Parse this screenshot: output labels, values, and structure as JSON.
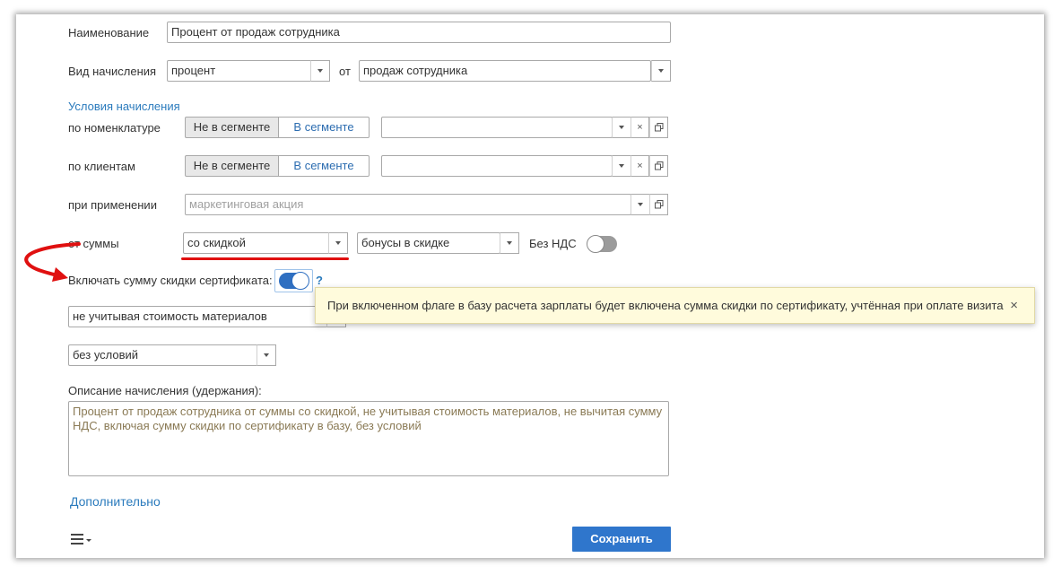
{
  "form": {
    "name_label": "Наименование",
    "name_value": "Процент от  продаж сотрудника",
    "accrual_type_label": "Вид начисления",
    "accrual_type_value": "процент",
    "from_label": "от",
    "from_value": "продаж сотрудника",
    "conditions_header": "Условия начисления",
    "nomenclature": {
      "label": "по номенклатуре",
      "not_in_segment": "Не в сегменте",
      "in_segment": "В сегменте",
      "value": "",
      "clear_symbol": "×"
    },
    "clients": {
      "label": "по клиентам",
      "not_in_segment": "Не в сегменте",
      "in_segment": "В сегменте",
      "value": "",
      "clear_symbol": "×"
    },
    "application": {
      "label": "при применении",
      "placeholder": "маркетинговая акция"
    },
    "sum": {
      "label": "от суммы",
      "value": "со скидкой",
      "bonus_value": "бонусы в скидке",
      "vat_label": "Без НДС",
      "vat_enabled": false
    },
    "certificate": {
      "label": "Включать сумму скидки сертификата:",
      "enabled": true,
      "help_symbol": "?"
    },
    "materials_value": "не учитывая стоимость материалов",
    "conditions_value": "без условий",
    "description_label": "Описание начисления (удержания):",
    "description_text": "Процент от продаж сотрудника от суммы со скидкой, не учитывая стоимость материалов, не вычитая сумму НДС, включая сумму скидки по сертификату в базу, без условий",
    "additional_link": "Дополнительно",
    "save_button": "Сохранить"
  },
  "tooltip": {
    "text": "При включенном флаге в базу расчета зарплаты будет включена сумма скидки по сертификату, учтённая при оплате визита",
    "close_symbol": "×"
  },
  "colors": {
    "accent": "#2f76cc",
    "link": "#2b7bbd",
    "annotation_red": "#e01010",
    "tooltip_bg": "#fffbdc"
  }
}
